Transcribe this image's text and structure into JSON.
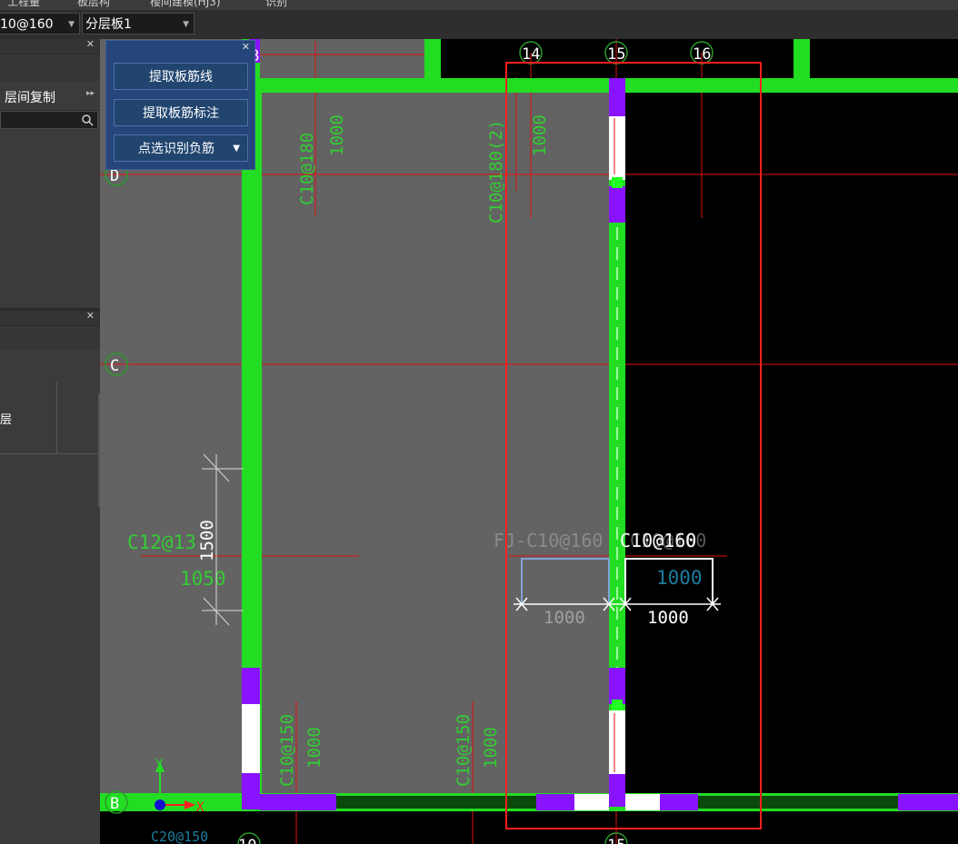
{
  "menu": {
    "items": [
      "工程量",
      "板层构",
      "楼间建模(HJ3)",
      "识别"
    ]
  },
  "toolbar": {
    "rebar_combo": "10@160",
    "layer_combo": "分层板1"
  },
  "left_panel": {
    "copy_layer_label": "层间复制",
    "table_cell": "层"
  },
  "float_panel": {
    "extract_line_label": "提取板筋线",
    "extract_annotation_label": "提取板筋标注",
    "pick_identify_label": "点选识别负筋"
  },
  "axis_labels": {
    "col_14": "14",
    "col_15": "15",
    "col_16": "16",
    "row_b": "B",
    "row_c": "C",
    "row_d": "D",
    "b_partial": "B",
    "bottom_15": "15",
    "bottom_10": "10"
  },
  "rebar_text": {
    "top_left_spec": "C10@180",
    "top_left_len": "1000",
    "top_mid_spec": "C10@180(2)",
    "top_mid_len": "1000",
    "left_spec": "C12@13",
    "left_len": "1050",
    "dim_1500": "1500",
    "bottom1_spec": "C10@150",
    "bottom1_len": "1000",
    "bottom2_spec": "C10@150",
    "bottom2_len": "1000",
    "fj_label": "FJ-C10@160",
    "fj_label2": "C10@160",
    "ghost_label": "C10@160",
    "dim_right": "1000",
    "dim_left": "1000",
    "dim_cyan": "1000",
    "bottom_partial": "C20@150"
  },
  "ucs": {
    "x": "X",
    "y": "Y"
  },
  "colors": {
    "wall_green": "#22dd22",
    "grid_red": "#e01010",
    "slab_gray": "#636363",
    "rebar_text_green": "#33cc33",
    "accent_purple": "#8a13ff",
    "selection_red": "#ff2020",
    "panel_blue": "#26457a"
  }
}
